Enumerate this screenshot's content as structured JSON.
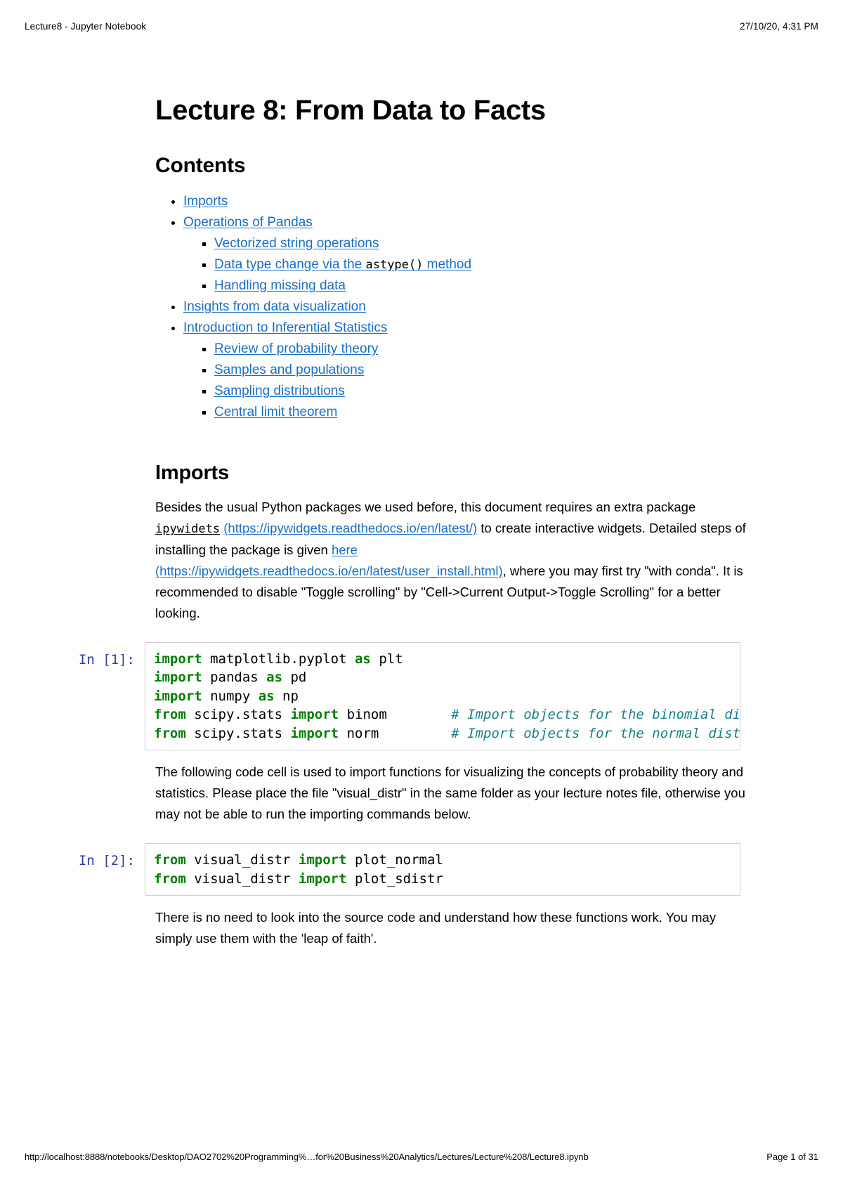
{
  "header": {
    "left": "Lecture8 - Jupyter Notebook",
    "right": "27/10/20, 4:31 PM"
  },
  "footer": {
    "url": "http://localhost:8888/notebooks/Desktop/DAO2702%20Programming%…for%20Business%20Analytics/Lectures/Lecture%208/Lecture8.ipynb",
    "page": "Page 1 of 31"
  },
  "document": {
    "title": "Lecture 8: From Data to Facts",
    "contents_heading": "Contents",
    "toc": [
      {
        "label": "Imports",
        "level": 1
      },
      {
        "label": "Operations of Pandas",
        "level": 1
      },
      {
        "label": "Vectorized string operations",
        "level": 2
      },
      {
        "label_prefix": "Data type change via the ",
        "code": "astype()",
        "label_suffix": " method",
        "level": 2
      },
      {
        "label": "Handling missing data",
        "level": 2
      },
      {
        "label": "Insights from data visualization",
        "level": 1
      },
      {
        "label": "Introduction to Inferential Statistics",
        "level": 1
      },
      {
        "label": "Review of probability theory",
        "level": 2
      },
      {
        "label": "Samples and populations",
        "level": 2
      },
      {
        "label": "Sampling distributions",
        "level": 2
      },
      {
        "label": "Central limit theorem",
        "level": 2
      }
    ],
    "imports_heading": "Imports",
    "paragraph1": {
      "t1": "Besides the usual Python packages we used before, this document requires an extra package ",
      "code1": "ipywidets",
      "link1": "(https://ipywidgets.readthedocs.io/en/latest/)",
      "t2": " to create interactive widgets. Detailed steps of installing the package is given ",
      "link2a": "here",
      "link2b": "(https://ipywidgets.readthedocs.io/en/latest/user_install.html)",
      "t3": ", where you may first try \"with conda\". It is recommended to disable \"Toggle scrolling\" by \"Cell->Current Output->Toggle Scrolling\" for a better looking."
    },
    "paragraph2": "The following code cell is used to import functions for visualizing the concepts of probability theory and statistics. Please place the file \"visual_distr\" in the same folder as your lecture notes file, otherwise you may not be able to run the importing commands below.",
    "paragraph3": "There is no need to look into the source code and understand how these functions work. You may simply use them with the 'leap of faith'."
  },
  "cells": [
    {
      "prompt": "In [1]:",
      "lines": [
        [
          {
            "t": "import",
            "c": "k"
          },
          {
            "t": " matplotlib.pyplot "
          },
          {
            "t": "as",
            "c": "k"
          },
          {
            "t": " plt"
          }
        ],
        [
          {
            "t": "import",
            "c": "k"
          },
          {
            "t": " pandas "
          },
          {
            "t": "as",
            "c": "k"
          },
          {
            "t": " pd"
          }
        ],
        [
          {
            "t": "import",
            "c": "k"
          },
          {
            "t": " numpy "
          },
          {
            "t": "as",
            "c": "k"
          },
          {
            "t": " np"
          }
        ],
        [
          {
            "t": "from",
            "c": "k"
          },
          {
            "t": " scipy.stats "
          },
          {
            "t": "import",
            "c": "k"
          },
          {
            "t": " binom        "
          },
          {
            "t": "# Import objects for the binomial distribution",
            "c": "c"
          }
        ],
        [
          {
            "t": "from",
            "c": "k"
          },
          {
            "t": " scipy.stats "
          },
          {
            "t": "import",
            "c": "k"
          },
          {
            "t": " norm         "
          },
          {
            "t": "# Import objects for the normal distribution",
            "c": "c"
          }
        ]
      ]
    },
    {
      "prompt": "In [2]:",
      "lines": [
        [
          {
            "t": "from",
            "c": "k"
          },
          {
            "t": " visual_distr "
          },
          {
            "t": "import",
            "c": "k"
          },
          {
            "t": " plot_normal"
          }
        ],
        [
          {
            "t": "from",
            "c": "k"
          },
          {
            "t": " visual_distr "
          },
          {
            "t": "import",
            "c": "k"
          },
          {
            "t": " plot_sdistr"
          }
        ]
      ]
    }
  ]
}
